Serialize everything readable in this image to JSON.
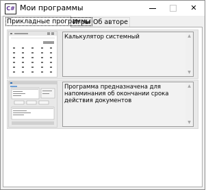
{
  "window": {
    "title": "Мои программы",
    "icon_glyph": "C#",
    "icon_name": "csharp-app-icon"
  },
  "tabs": [
    {
      "label": "Прикладные программы",
      "active": true
    },
    {
      "label": "Игры",
      "active": false
    },
    {
      "label": "Об авторе",
      "active": false
    }
  ],
  "programs": [
    {
      "description": "Калькулятор системный",
      "thumbnail": "calculator-screenshot"
    },
    {
      "description": "Программа предназначена для напоминания об окончании срока действия документов",
      "thumbnail": "reminder-app-screenshot"
    }
  ],
  "colors": {
    "page_bg": "#ffffff",
    "card_bg": "#e9e9e9",
    "desc_bg": "#f2f2f2"
  }
}
